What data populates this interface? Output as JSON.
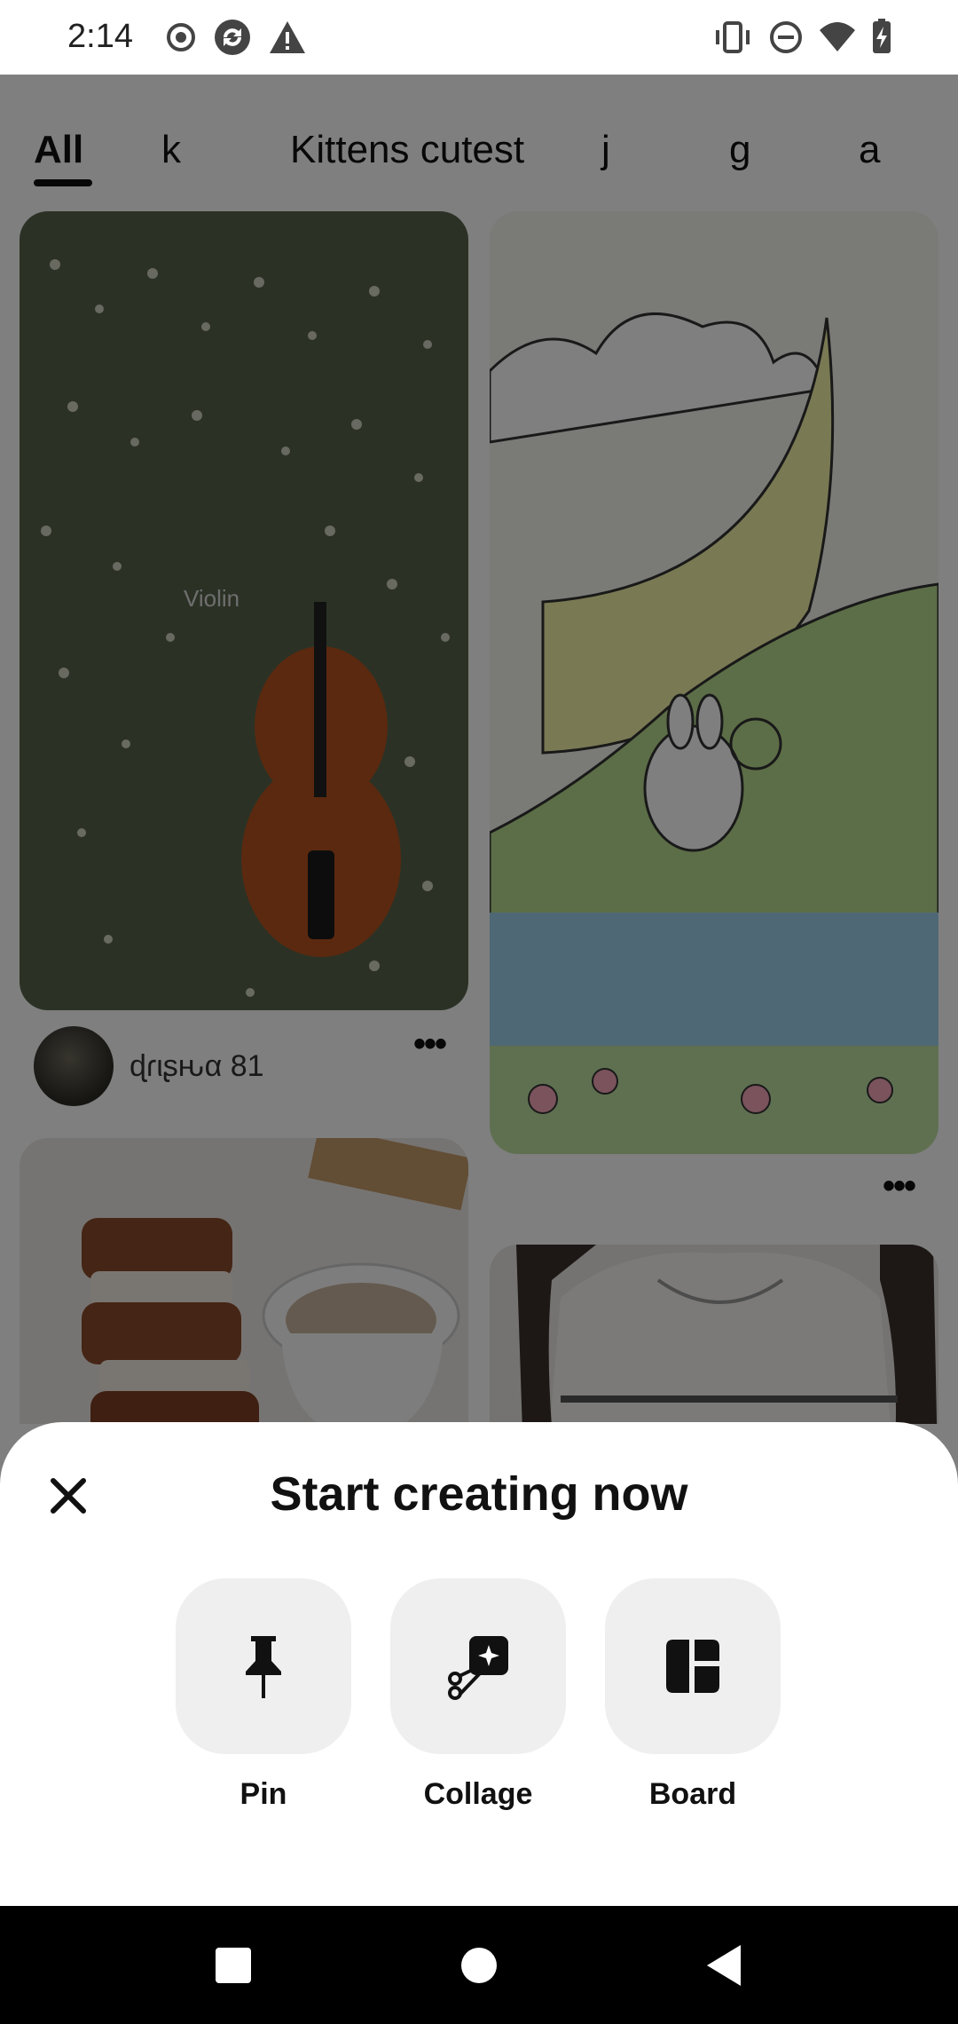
{
  "status_bar": {
    "time": "2:14",
    "left_icons": [
      "record-icon",
      "sync-icon",
      "warning-icon"
    ],
    "right_icons": [
      "vibrate-icon",
      "do-not-disturb-icon",
      "wifi-icon",
      "battery-charging-icon"
    ]
  },
  "feed": {
    "tabs": [
      {
        "label": "All",
        "active": true
      },
      {
        "label": "k"
      },
      {
        "label": "Kittens cutest"
      },
      {
        "label": "j"
      },
      {
        "label": "g"
      },
      {
        "label": "a"
      }
    ],
    "pins": [
      {
        "image": "violin-in-flower-field",
        "overlay_text": "Violin",
        "owner": {
          "name": "ɖɾιʂԋα 81"
        }
      },
      {
        "image": "bunny-moon-illustration"
      },
      {
        "image": "biscuits-and-coffee"
      },
      {
        "image": "striped-sweater"
      }
    ],
    "more_icon": "more-dots-icon"
  },
  "sheet": {
    "title": "Start creating now",
    "close_icon": "close-icon",
    "options": [
      {
        "label": "Pin",
        "icon": "pushpin-icon"
      },
      {
        "label": "Collage",
        "icon": "collage-scissors-icon"
      },
      {
        "label": "Board",
        "icon": "board-layout-icon"
      }
    ]
  },
  "nav_bar": {
    "buttons": [
      "recents-square-icon",
      "home-circle-icon",
      "back-triangle-icon"
    ]
  },
  "colors": {
    "scrim": "rgba(0,0,0,0.5)",
    "tile_bg": "#efefef",
    "nav_bg": "#000000"
  }
}
